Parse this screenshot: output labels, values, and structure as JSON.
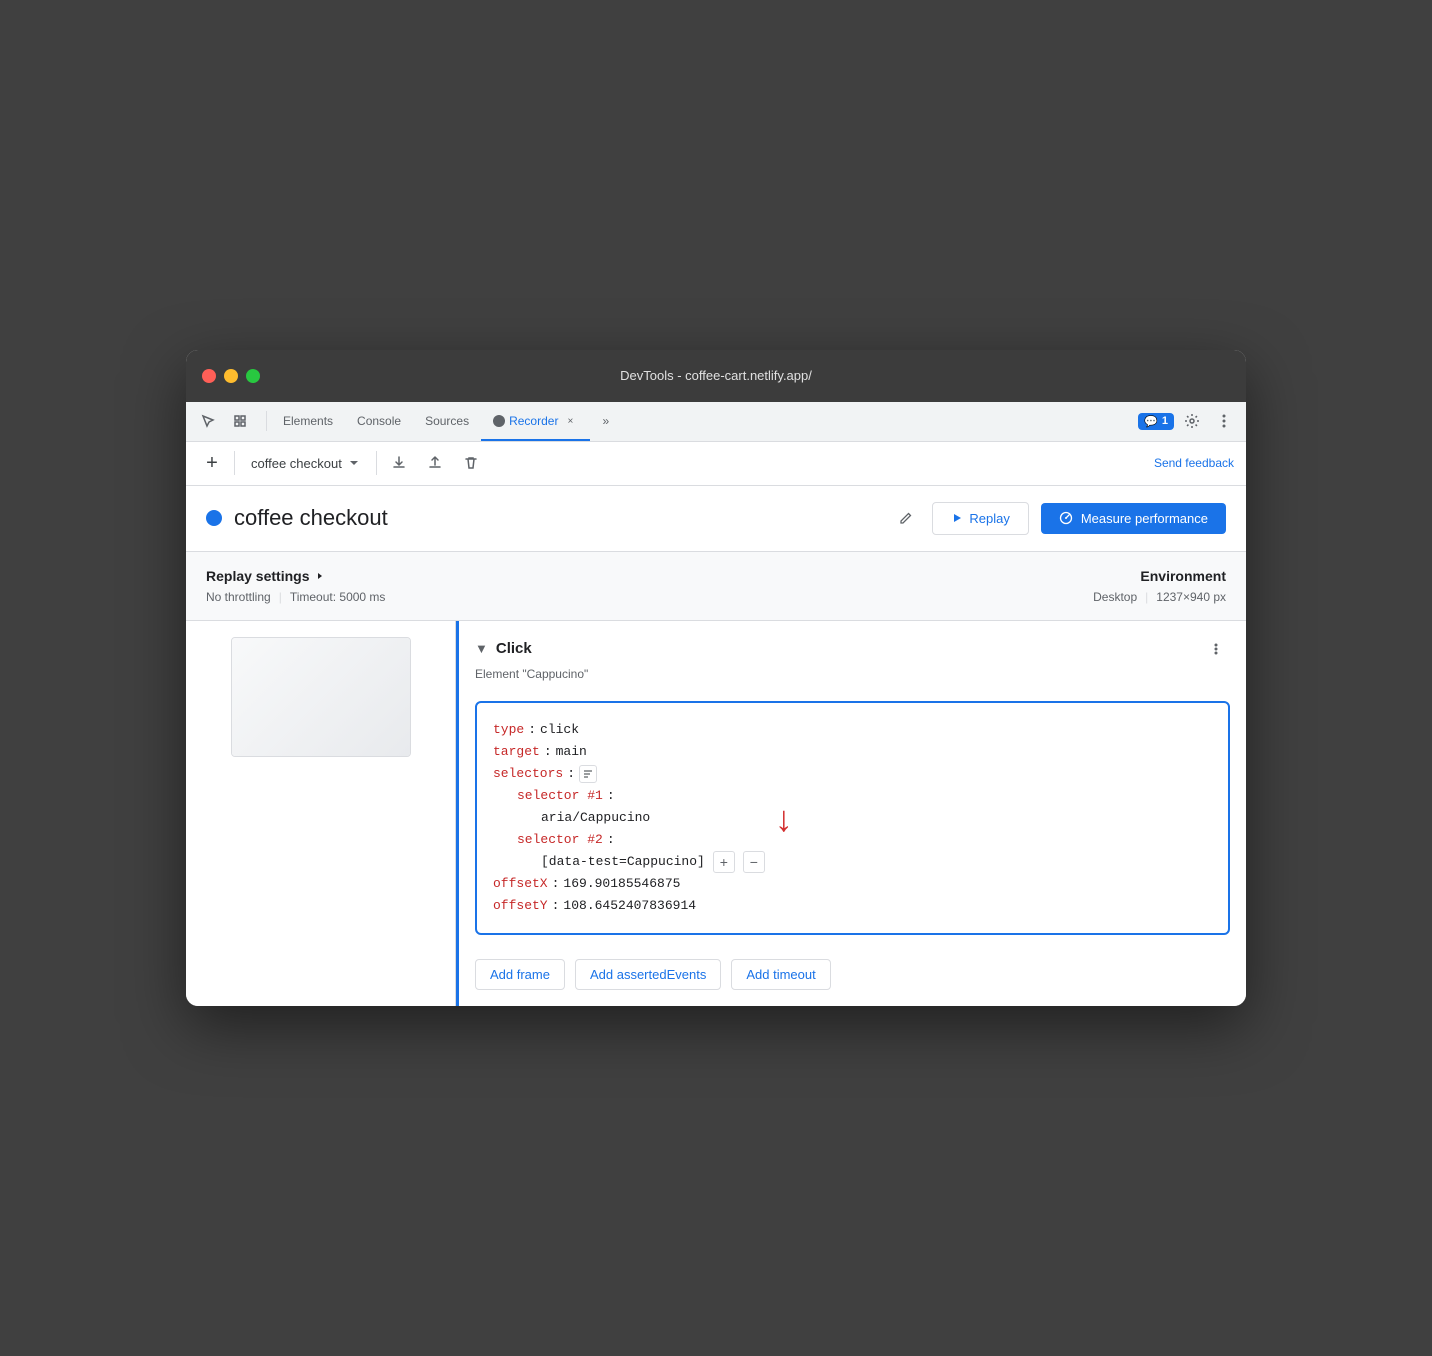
{
  "window": {
    "title": "DevTools - coffee-cart.netlify.app/"
  },
  "tabs": [
    {
      "id": "elements",
      "label": "Elements",
      "active": false
    },
    {
      "id": "console",
      "label": "Console",
      "active": false
    },
    {
      "id": "sources",
      "label": "Sources",
      "active": false
    },
    {
      "id": "recorder",
      "label": "Recorder",
      "active": true
    },
    {
      "id": "more",
      "label": "»",
      "active": false
    }
  ],
  "notification": {
    "icon": "💬",
    "count": "1"
  },
  "toolbar": {
    "add_label": "+",
    "recording_name": "coffee checkout",
    "send_feedback": "Send feedback"
  },
  "recording": {
    "title": "coffee checkout",
    "replay_label": "Replay",
    "measure_label": "Measure performance"
  },
  "settings": {
    "title": "Replay settings",
    "throttling": "No throttling",
    "timeout": "Timeout: 5000 ms",
    "environment_title": "Environment",
    "device": "Desktop",
    "resolution": "1237×940 px"
  },
  "step": {
    "type": "Click",
    "element": "Element \"Cappucino\"",
    "code": {
      "type_key": "type",
      "type_val": "click",
      "target_key": "target",
      "target_val": "main",
      "selectors_key": "selectors",
      "selector1_key": "selector #1",
      "selector1_val": "aria/Cappucino",
      "selector2_key": "selector #2",
      "selector2_val": "[data-test=Cappucino]",
      "offsetX_key": "offsetX",
      "offsetX_val": "169.90185546875",
      "offsetY_key": "offsetY",
      "offsetY_val": "108.6452407836914"
    },
    "buttons": {
      "add_frame": "Add frame",
      "add_asserted": "Add assertedEvents",
      "add_timeout": "Add timeout"
    }
  }
}
